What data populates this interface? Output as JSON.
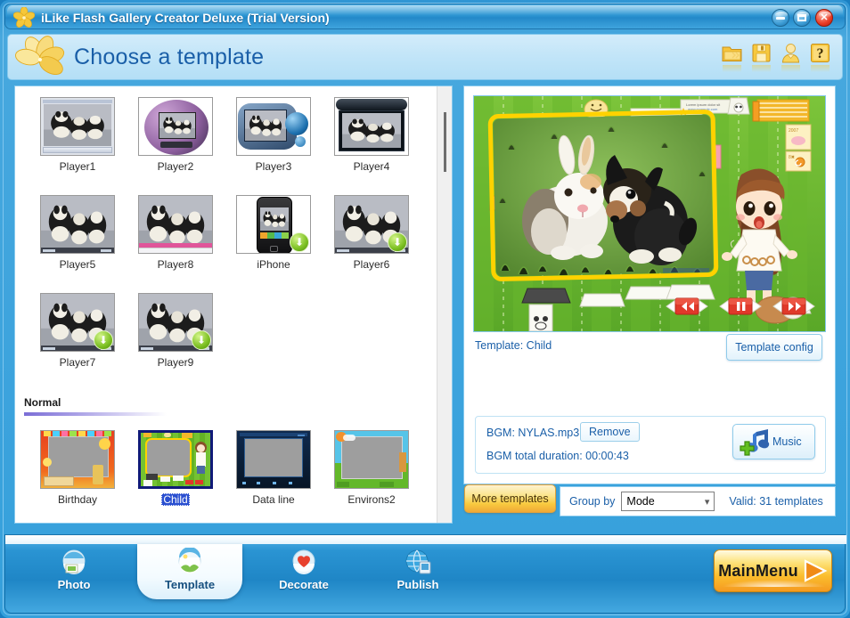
{
  "window": {
    "title": "iLike Flash Gallery Creator Deluxe (Trial Version)",
    "logo_icon": "flower-logo-icon",
    "minimize_icon": "minimize-icon",
    "maximize_icon": "maximize-icon",
    "close_icon": "close-icon",
    "accent_color": "#2e96d2"
  },
  "header": {
    "title": "Choose a template",
    "flower_icon": "flower-logo-icon",
    "icons": [
      {
        "name": "open-folder-icon",
        "glyph": "folder"
      },
      {
        "name": "save-icon",
        "glyph": "floppy"
      },
      {
        "name": "user-account-icon",
        "glyph": "person"
      },
      {
        "name": "help-icon",
        "glyph": "?"
      }
    ]
  },
  "template_list": {
    "groups": [
      {
        "label": "",
        "items": [
          {
            "label": "Player1",
            "thumb": "player-skin-silver",
            "badge": ""
          },
          {
            "label": "Player2",
            "thumb": "player-skin-purple-round",
            "badge": ""
          },
          {
            "label": "Player3",
            "thumb": "player-skin-blue-pod",
            "badge": ""
          },
          {
            "label": "Player4",
            "thumb": "player-skin-dark-panel",
            "badge": ""
          },
          {
            "label": "Player5",
            "thumb": "player-skin-plain",
            "badge": ""
          },
          {
            "label": "Player8",
            "thumb": "player-skin-pink-bar",
            "badge": ""
          },
          {
            "label": "iPhone",
            "thumb": "player-skin-iphone",
            "badge": "download-badge-icon"
          },
          {
            "label": "Player6",
            "thumb": "player-skin-plain",
            "badge": "download-badge-icon"
          },
          {
            "label": "Player7",
            "thumb": "player-skin-plain",
            "badge": "download-badge-icon"
          },
          {
            "label": "Player9",
            "thumb": "player-skin-plain",
            "badge": "download-badge-icon"
          }
        ]
      },
      {
        "label": "Normal",
        "items": [
          {
            "label": "Birthday",
            "thumb": "template-birthday",
            "badge": "",
            "selected": false
          },
          {
            "label": "Child",
            "thumb": "template-child",
            "badge": "",
            "selected": true
          },
          {
            "label": "Data line",
            "thumb": "template-dataline",
            "badge": "",
            "selected": false
          },
          {
            "label": "Environs2",
            "thumb": "template-environs2",
            "badge": "",
            "selected": false
          }
        ]
      }
    ],
    "scrollbar": {
      "name": "vertical-scrollbar",
      "thumb_position_pct": 6
    }
  },
  "preview": {
    "template_label": "Template:  Child",
    "config_button": "Template config",
    "playback": [
      {
        "name": "rewind-button",
        "glyph": "◀◀"
      },
      {
        "name": "pause-button",
        "glyph": "❙❙"
      },
      {
        "name": "forward-button",
        "glyph": "▶▶"
      }
    ]
  },
  "bgm": {
    "name_label": "BGM: NYLAS.mp3",
    "remove_label": "Remove",
    "duration_label": "BGM total duration: 00:00:43",
    "music_button_label": "Music",
    "music_icon": "add-music-note-icon"
  },
  "toolbar": {
    "more_templates_label": "More templates",
    "group_by_label": "Group by",
    "group_by_value": "Mode",
    "group_by_options": [
      "Mode"
    ],
    "valid_count_label": "Valid: 31 templates"
  },
  "footer": {
    "tabs": [
      {
        "label": "Photo",
        "icon": "photo-globe-icon",
        "active": false
      },
      {
        "label": "Template",
        "icon": "template-globe-icon",
        "active": true
      },
      {
        "label": "Decorate",
        "icon": "heart-globe-icon",
        "active": false
      },
      {
        "label": "Publish",
        "icon": "publish-globe-icon",
        "active": false
      }
    ],
    "main_menu_label": "MainMenu",
    "main_menu_arrow_icon": "play-triangle-icon"
  }
}
